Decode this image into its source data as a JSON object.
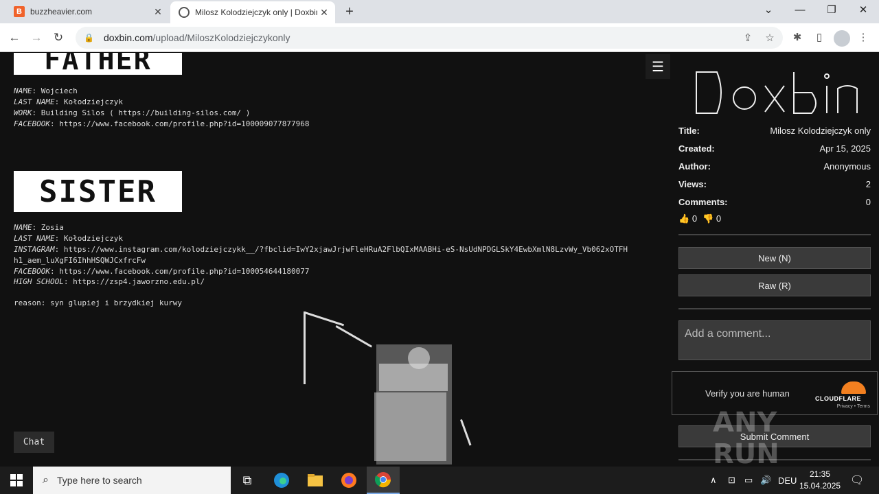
{
  "browser": {
    "tabs": [
      {
        "label": "buzzheavier.com",
        "favicon": "B"
      },
      {
        "label": "Milosz Kolodziejczyk only | Doxbin",
        "active": true
      }
    ],
    "address": {
      "domain": "doxbin.com",
      "path": "/upload/MiloszKolodziejczykonly"
    }
  },
  "paste": {
    "father_banner": "FATHER",
    "father": [
      {
        "key": "NAME",
        "value": "Wojciech"
      },
      {
        "key": "LAST NAME",
        "value": "Kołodziejczyk"
      },
      {
        "key": "WORK",
        "value": "Building Silos ( https://building-silos.com/ )"
      },
      {
        "key": "FACEBOOK",
        "value": "https://www.facebook.com/profile.php?id=100009077877968"
      }
    ],
    "sister_banner": "SISTER",
    "sister": [
      {
        "key": "NAME",
        "value": "Zosia"
      },
      {
        "key": "LAST NAME",
        "value": "Kołodziejczyk"
      },
      {
        "key": "INSTAGRAM",
        "value": "https://www.instagram.com/kolodziejczykk__/?fbclid=IwY2xjawJrjwFleHRuA2FlbQIxMAABHi-eS-NsUdNPDGLSkY4EwbXmlN8LzvWy_Vb062xOTFH"
      },
      {
        "key": "",
        "value": "h1_aem_luXgFI6IhhHSQWJCxfrcFw"
      },
      {
        "key": "FACEBOOK",
        "value": "https://www.facebook.com/profile.php?id=100054644180077"
      },
      {
        "key": "HIGH SCHOOL",
        "value": "https://zsp4.jaworzno.edu.pl/"
      }
    ],
    "reason": "reason: syn glupiej i brzydkiej kurwy"
  },
  "chat_label": "Chat",
  "sidebar": {
    "meta": [
      {
        "key": "Title:",
        "value": "Milosz Kolodziejczyk only"
      },
      {
        "key": "Created:",
        "value": "Apr 15, 2025"
      },
      {
        "key": "Author:",
        "value": "Anonymous"
      },
      {
        "key": "Views:",
        "value": "2"
      },
      {
        "key": "Comments:",
        "value": "0"
      }
    ],
    "likes": "0",
    "dislikes": "0",
    "new_button": "New (N)",
    "raw_button": "Raw (R)",
    "comment_placeholder": "Add a comment...",
    "captcha_label": "Verify you are human",
    "captcha_brand": "CLOUDFLARE",
    "captcha_privacy": "Privacy",
    "captcha_terms": "Terms",
    "submit_button": "Submit Comment"
  },
  "watermark": "ANY RUN",
  "taskbar": {
    "search_placeholder": "Type here to search",
    "language": "DEU",
    "time": "21:35",
    "date": "15.04.2025"
  }
}
